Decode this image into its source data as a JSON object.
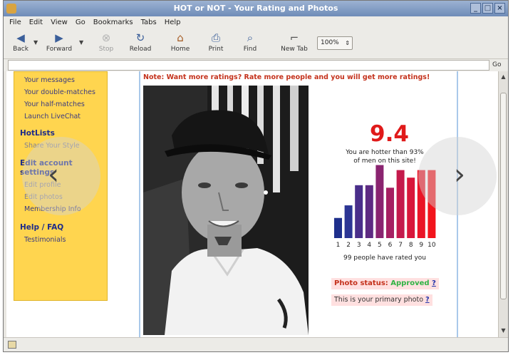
{
  "window": {
    "title": "HOT or NOT - Your Rating and Photos"
  },
  "menu": [
    "File",
    "Edit",
    "View",
    "Go",
    "Bookmarks",
    "Tabs",
    "Help"
  ],
  "toolbar": {
    "back": "Back",
    "forward": "Forward",
    "stop": "Stop",
    "reload": "Reload",
    "home": "Home",
    "print": "Print",
    "find": "Find",
    "new_tab": "New Tab",
    "zoom": "100%"
  },
  "urlbar": {
    "go": "Go"
  },
  "sidebar": {
    "links_top": [
      "Your messages",
      "Your double-matches",
      "Your half-matches",
      "Launch LiveChat"
    ],
    "hotlists": {
      "heading": "HotLists",
      "links": [
        "Share Your Style"
      ]
    },
    "account": {
      "heading": "Edit account settings",
      "links": [
        "Edit profile",
        "Edit photos",
        "Membership Info"
      ]
    },
    "help": {
      "heading": "Help / FAQ",
      "links": [
        "Testimonials"
      ]
    }
  },
  "main": {
    "note": "Note: Want more ratings? Rate more people and you will get more ratings!",
    "score": "9.4",
    "hotter_line1": "You are hotter than 93%",
    "hotter_line2": "of men on this site!",
    "rated": "99 people have rated you",
    "photo_status_label": "Photo status:",
    "photo_status_value": "Approved",
    "primary_text": "This is your primary photo",
    "help_mark": "?"
  },
  "colors": {
    "status_approved": "#2fb344",
    "score": "#e01a1a",
    "sidebar": "#ffd54f"
  },
  "chart_data": {
    "type": "bar",
    "categories": [
      "1",
      "2",
      "3",
      "4",
      "5",
      "6",
      "7",
      "8",
      "9",
      "10"
    ],
    "values": [
      4,
      6.5,
      10.5,
      10.5,
      14.5,
      10,
      13.5,
      12,
      13.5,
      13.5
    ],
    "colors": [
      "#1e2f8c",
      "#2c3594",
      "#4a2e8a",
      "#5e2a82",
      "#8a2470",
      "#a62062",
      "#c41a4c",
      "#d8163a",
      "#ea1426",
      "#f2141c"
    ],
    "ylim": [
      0,
      15
    ],
    "title": "",
    "xlabel": "",
    "ylabel": ""
  }
}
